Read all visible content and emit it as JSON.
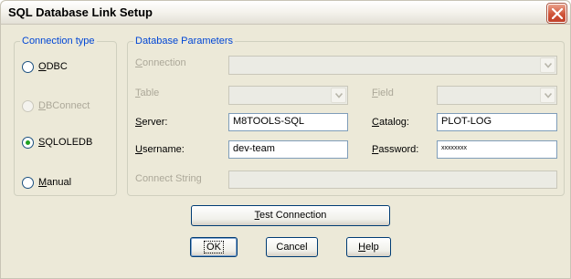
{
  "window": {
    "title": "SQL Database Link Setup"
  },
  "connection_type": {
    "legend": "Connection type",
    "options": [
      {
        "prefix": "",
        "key": "O",
        "rest": "DBC",
        "selected": false,
        "enabled": true
      },
      {
        "prefix": "",
        "key": "D",
        "rest": "BConnect",
        "selected": false,
        "enabled": false
      },
      {
        "prefix": "",
        "key": "S",
        "rest": "QLOLEDB",
        "selected": true,
        "enabled": true
      },
      {
        "prefix": "",
        "key": "M",
        "rest": "anual",
        "selected": false,
        "enabled": true
      }
    ]
  },
  "params": {
    "legend": "Database Parameters",
    "connection": {
      "key": "C",
      "rest": "onnection",
      "value": ""
    },
    "table": {
      "key": "T",
      "rest": "able",
      "value": ""
    },
    "field": {
      "key": "F",
      "rest": "ield",
      "value": ""
    },
    "server": {
      "key": "S",
      "rest": "erver:",
      "value": "M8TOOLS-SQL"
    },
    "catalog": {
      "key": "C",
      "rest": "atalog:",
      "value": "PLOT-LOG"
    },
    "username": {
      "key": "U",
      "rest": "sername:",
      "value": "dev-team"
    },
    "password": {
      "key": "P",
      "rest": "assword:",
      "value": "xxxxxxxx"
    },
    "connect_string": {
      "label": "Connect String",
      "value": ""
    }
  },
  "buttons": {
    "test": {
      "key": "T",
      "rest": "est Connection"
    },
    "ok": {
      "key": "",
      "rest": "OK"
    },
    "cancel": {
      "key": "",
      "rest": "Cancel"
    },
    "help": {
      "key": "H",
      "rest": "elp"
    }
  },
  "colors": {
    "legend": "#0046d5",
    "selected_radio": "#21a121",
    "close_button": "#d0553a"
  }
}
